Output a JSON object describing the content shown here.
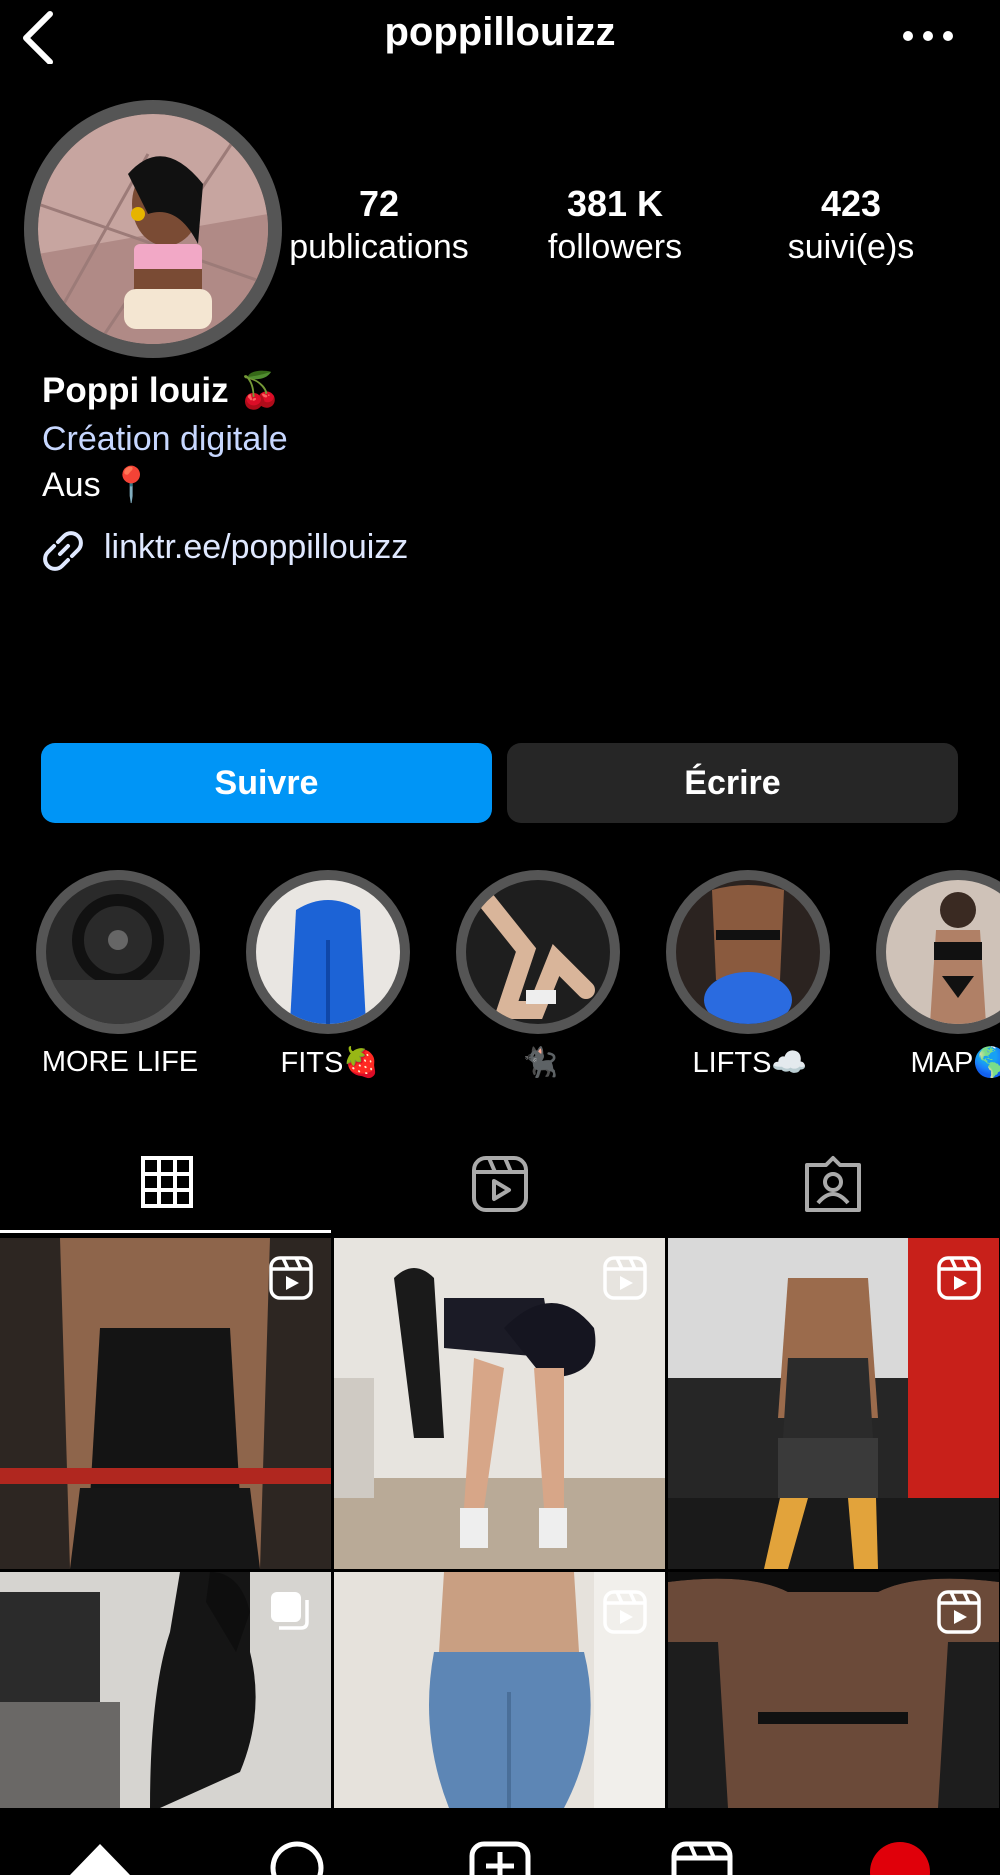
{
  "header": {
    "username": "poppillouizz",
    "back_icon": "chevron-left-icon",
    "more_icon": "more-horizontal-icon"
  },
  "profile": {
    "stats": [
      {
        "value": "72",
        "label": "publications"
      },
      {
        "value": "381 K",
        "label": "followers"
      },
      {
        "value": "423",
        "label": "suivi(e)s"
      }
    ],
    "display_name": "Poppi louiz 🍒",
    "category": "Création digitale",
    "location": "Aus 📍",
    "link": "linktr.ee/poppillouizz"
  },
  "actions": {
    "follow_label": "Suivre",
    "message_label": "Écrire"
  },
  "highlights": [
    {
      "label": "MORE LIFE"
    },
    {
      "label": "FITS🍓"
    },
    {
      "label": "🐈‍⬛"
    },
    {
      "label": "LIFTS☁️"
    },
    {
      "label": "MAP🌎"
    }
  ],
  "tabs": [
    {
      "name": "grid",
      "icon": "grid-icon",
      "active": true
    },
    {
      "name": "reels",
      "icon": "reels-icon",
      "active": false
    },
    {
      "name": "tagged",
      "icon": "tagged-icon",
      "active": false
    }
  ],
  "posts": [
    {
      "type": "reel",
      "icon": "reel-icon"
    },
    {
      "type": "reel",
      "icon": "reel-icon"
    },
    {
      "type": "reel",
      "icon": "reel-icon"
    },
    {
      "type": "carousel",
      "icon": "carousel-icon"
    },
    {
      "type": "reel",
      "icon": "reel-icon"
    },
    {
      "type": "reel",
      "icon": "reel-icon"
    }
  ],
  "bottom_nav": [
    {
      "icon": "home-icon"
    },
    {
      "icon": "search-icon"
    },
    {
      "icon": "add-post-icon"
    },
    {
      "icon": "reels-icon"
    },
    {
      "icon": "profile-avatar-icon"
    }
  ],
  "colors": {
    "accent": "#0095f6",
    "secondary_button": "#262626",
    "link": "#dfe8ff",
    "category_text": "#c7d7ff"
  }
}
